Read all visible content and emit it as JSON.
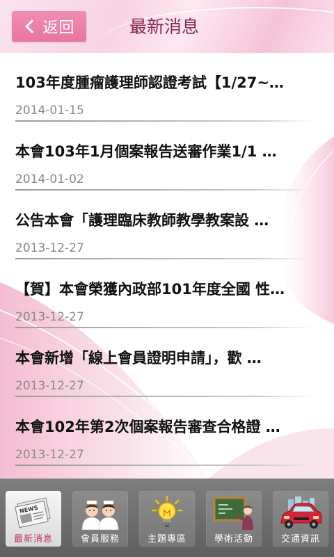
{
  "header": {
    "back_label": "返回",
    "title": "最新消息"
  },
  "news": [
    {
      "title": "103年度腫瘤護理師認證考試【1/27~…",
      "date": "2014-01-15"
    },
    {
      "title": "本會103年1月個案報告送審作業1/1 …",
      "date": "2014-01-02"
    },
    {
      "title": "公告本會「護理臨床教師教學教案設 …",
      "date": "2013-12-27"
    },
    {
      "title": "【賀】本會榮獲內政部101年度全國 性…",
      "date": "2013-12-27"
    },
    {
      "title": "本會新增「線上會員證明申請」，歡 …",
      "date": "2013-12-27"
    },
    {
      "title": "本會102年第2次個案報告審查合格證 …",
      "date": "2013-12-27"
    }
  ],
  "tabs": [
    {
      "label": "最新消息",
      "icon": "newspaper-icon",
      "active": true
    },
    {
      "label": "會員服務",
      "icon": "nurses-icon",
      "active": false
    },
    {
      "label": "主題專區",
      "icon": "lightbulb-icon",
      "active": false
    },
    {
      "label": "學術活動",
      "icon": "chalkboard-icon",
      "active": false
    },
    {
      "label": "交通資訊",
      "icon": "car-icon",
      "active": false
    }
  ],
  "colors": {
    "accent": "#e8769f",
    "title": "#8a2a4f",
    "active_tab_label": "#c0306a"
  }
}
